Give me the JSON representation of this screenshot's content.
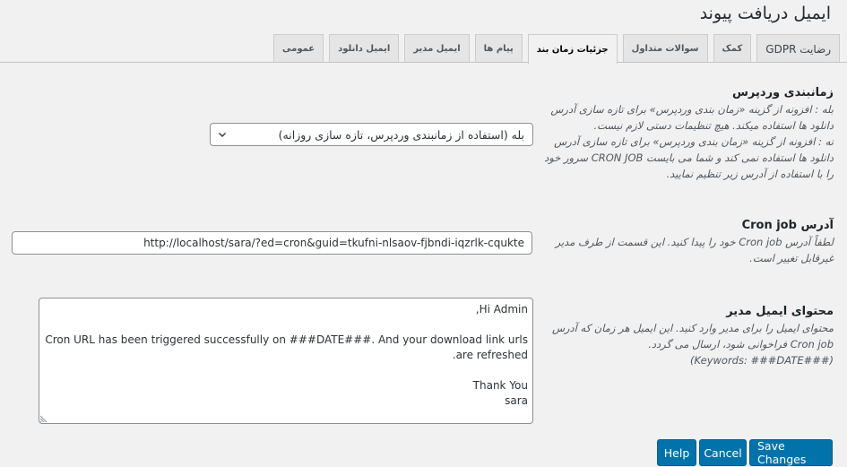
{
  "page": {
    "title": "ایمیل دریافت پیوند"
  },
  "tabs": [
    {
      "label": "عمومی",
      "active": false
    },
    {
      "label": "ایمیل دانلود",
      "active": false
    },
    {
      "label": "ایمیل مدیر",
      "active": false
    },
    {
      "label": "پیام ها",
      "active": false
    },
    {
      "label": "جزئیات زمان بند",
      "active": true
    },
    {
      "label": "سوالات متداول",
      "active": false
    },
    {
      "label": "کمک",
      "active": false
    },
    {
      "label": "رضایت GDPR",
      "active": false
    }
  ],
  "sections": {
    "scheduler": {
      "title": "زمانبندی وردپرس",
      "description": "بله : افزونه از گزینه «زمان بندی وردپرس» برای تازه سازی آدرس دانلود ها استفاده میکند. هیچ تنظیمات دستی لازم نیست.\nنه : افزونه از گزینه «زمان بندی وردپرس» برای تازه سازی آدرس دانلود ها استفاده نمی کند و شما می بایست CRON JOB سرور خود را با استفاده از آدرس زیر تنظیم نمایید.",
      "select_value": "بله (استفاده از زمانبندی وردپرس، تازه سازی روزانه)"
    },
    "cron": {
      "title": "آدرس Cron job",
      "description": "لطفاً آدرس Cron job خود را پیدا کنید. این قسمت از طرف مدیر غیرقابل تغییر است.",
      "url_value": "http://localhost/sara/?ed=cron&guid=tkufni-nlsaov-fjbndi-iqzrlk-cqukte"
    },
    "admin_email": {
      "title": "محتوای ایمیل مدیر",
      "description": "محتوای ایمیل را برای مدیر وارد کنید. این ایمیل هر زمان که آدرس Cron job فراخوانی شود، ارسال می گردد.\n(###Keywords: ###DATE)",
      "content_lines": [
        "Hi Admin,",
        "",
        "Cron URL has been triggered successfully on ###DATE###. And your download link urls are refreshed.",
        "",
        "Thank You",
        "sara"
      ]
    }
  },
  "buttons": {
    "save": "Save Changes",
    "cancel": "Cancel",
    "help": "Help"
  },
  "colors": {
    "primary_button": "#0273aa",
    "background": "#f1f1f1"
  }
}
